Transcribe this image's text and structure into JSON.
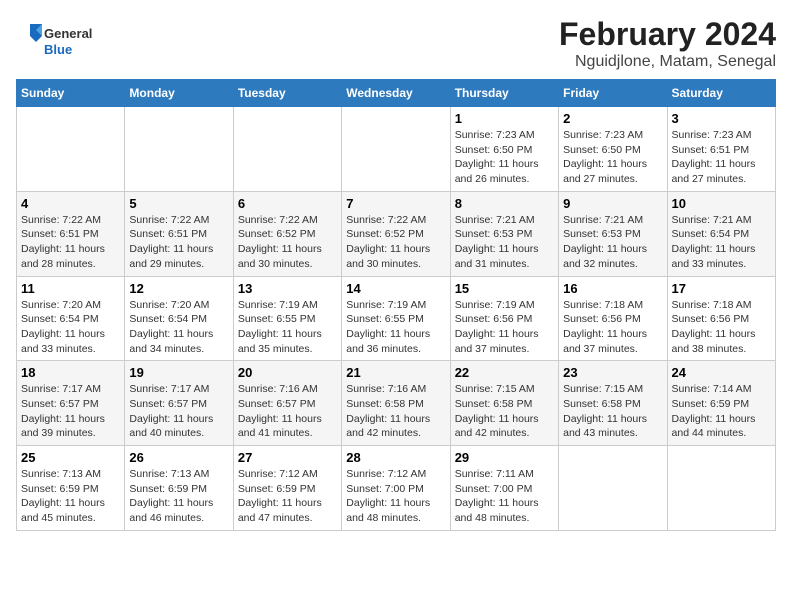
{
  "logo": {
    "general": "General",
    "blue": "Blue"
  },
  "title": "February 2024",
  "subtitle": "Nguidjlone, Matam, Senegal",
  "days_of_week": [
    "Sunday",
    "Monday",
    "Tuesday",
    "Wednesday",
    "Thursday",
    "Friday",
    "Saturday"
  ],
  "weeks": [
    [
      {
        "day": "",
        "info": ""
      },
      {
        "day": "",
        "info": ""
      },
      {
        "day": "",
        "info": ""
      },
      {
        "day": "",
        "info": ""
      },
      {
        "day": "1",
        "sunrise": "7:23 AM",
        "sunset": "6:50 PM",
        "daylight": "11 hours and 26 minutes."
      },
      {
        "day": "2",
        "sunrise": "7:23 AM",
        "sunset": "6:50 PM",
        "daylight": "11 hours and 27 minutes."
      },
      {
        "day": "3",
        "sunrise": "7:23 AM",
        "sunset": "6:51 PM",
        "daylight": "11 hours and 27 minutes."
      }
    ],
    [
      {
        "day": "4",
        "sunrise": "7:22 AM",
        "sunset": "6:51 PM",
        "daylight": "11 hours and 28 minutes."
      },
      {
        "day": "5",
        "sunrise": "7:22 AM",
        "sunset": "6:51 PM",
        "daylight": "11 hours and 29 minutes."
      },
      {
        "day": "6",
        "sunrise": "7:22 AM",
        "sunset": "6:52 PM",
        "daylight": "11 hours and 30 minutes."
      },
      {
        "day": "7",
        "sunrise": "7:22 AM",
        "sunset": "6:52 PM",
        "daylight": "11 hours and 30 minutes."
      },
      {
        "day": "8",
        "sunrise": "7:21 AM",
        "sunset": "6:53 PM",
        "daylight": "11 hours and 31 minutes."
      },
      {
        "day": "9",
        "sunrise": "7:21 AM",
        "sunset": "6:53 PM",
        "daylight": "11 hours and 32 minutes."
      },
      {
        "day": "10",
        "sunrise": "7:21 AM",
        "sunset": "6:54 PM",
        "daylight": "11 hours and 33 minutes."
      }
    ],
    [
      {
        "day": "11",
        "sunrise": "7:20 AM",
        "sunset": "6:54 PM",
        "daylight": "11 hours and 33 minutes."
      },
      {
        "day": "12",
        "sunrise": "7:20 AM",
        "sunset": "6:54 PM",
        "daylight": "11 hours and 34 minutes."
      },
      {
        "day": "13",
        "sunrise": "7:19 AM",
        "sunset": "6:55 PM",
        "daylight": "11 hours and 35 minutes."
      },
      {
        "day": "14",
        "sunrise": "7:19 AM",
        "sunset": "6:55 PM",
        "daylight": "11 hours and 36 minutes."
      },
      {
        "day": "15",
        "sunrise": "7:19 AM",
        "sunset": "6:56 PM",
        "daylight": "11 hours and 37 minutes."
      },
      {
        "day": "16",
        "sunrise": "7:18 AM",
        "sunset": "6:56 PM",
        "daylight": "11 hours and 37 minutes."
      },
      {
        "day": "17",
        "sunrise": "7:18 AM",
        "sunset": "6:56 PM",
        "daylight": "11 hours and 38 minutes."
      }
    ],
    [
      {
        "day": "18",
        "sunrise": "7:17 AM",
        "sunset": "6:57 PM",
        "daylight": "11 hours and 39 minutes."
      },
      {
        "day": "19",
        "sunrise": "7:17 AM",
        "sunset": "6:57 PM",
        "daylight": "11 hours and 40 minutes."
      },
      {
        "day": "20",
        "sunrise": "7:16 AM",
        "sunset": "6:57 PM",
        "daylight": "11 hours and 41 minutes."
      },
      {
        "day": "21",
        "sunrise": "7:16 AM",
        "sunset": "6:58 PM",
        "daylight": "11 hours and 42 minutes."
      },
      {
        "day": "22",
        "sunrise": "7:15 AM",
        "sunset": "6:58 PM",
        "daylight": "11 hours and 42 minutes."
      },
      {
        "day": "23",
        "sunrise": "7:15 AM",
        "sunset": "6:58 PM",
        "daylight": "11 hours and 43 minutes."
      },
      {
        "day": "24",
        "sunrise": "7:14 AM",
        "sunset": "6:59 PM",
        "daylight": "11 hours and 44 minutes."
      }
    ],
    [
      {
        "day": "25",
        "sunrise": "7:13 AM",
        "sunset": "6:59 PM",
        "daylight": "11 hours and 45 minutes."
      },
      {
        "day": "26",
        "sunrise": "7:13 AM",
        "sunset": "6:59 PM",
        "daylight": "11 hours and 46 minutes."
      },
      {
        "day": "27",
        "sunrise": "7:12 AM",
        "sunset": "6:59 PM",
        "daylight": "11 hours and 47 minutes."
      },
      {
        "day": "28",
        "sunrise": "7:12 AM",
        "sunset": "7:00 PM",
        "daylight": "11 hours and 48 minutes."
      },
      {
        "day": "29",
        "sunrise": "7:11 AM",
        "sunset": "7:00 PM",
        "daylight": "11 hours and 48 minutes."
      },
      {
        "day": "",
        "info": ""
      },
      {
        "day": "",
        "info": ""
      }
    ]
  ],
  "labels": {
    "sunrise": "Sunrise:",
    "sunset": "Sunset:",
    "daylight": "Daylight:"
  }
}
